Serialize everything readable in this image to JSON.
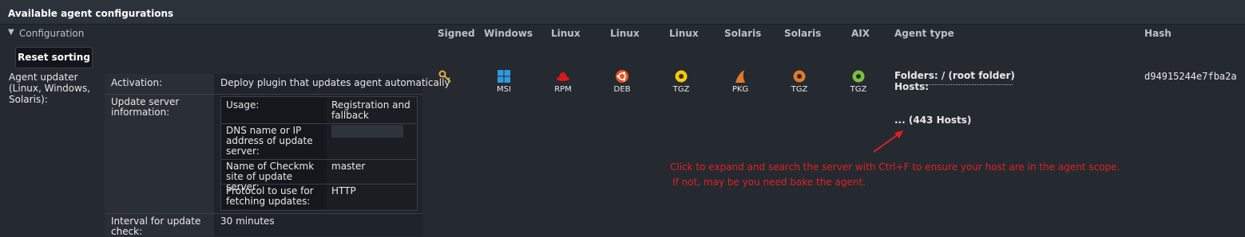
{
  "title": "Available agent configurations",
  "headers": {
    "configuration": "Configuration",
    "signed": "Signed",
    "windows": "Windows",
    "linux1": "Linux",
    "linux2": "Linux",
    "linux3": "Linux",
    "solaris1": "Solaris",
    "solaris2": "Solaris",
    "aix": "AIX",
    "agent_type": "Agent type",
    "hash": "Hash"
  },
  "reset_button": "Reset sorting",
  "agent_updater_label": "Agent updater (Linux, Windows, Solaris):",
  "activation": {
    "label": "Activation:",
    "value": "Deploy plugin that updates agent automatically"
  },
  "update_server": {
    "label": "Update server information:",
    "usage_label": "Usage:",
    "usage_value": "Registration and fallback",
    "dns_label": "DNS name or IP address of update server:",
    "site_label": "Name of Checkmk site of update server:",
    "site_value": "master",
    "protocol_label": "Protocol to use for fetching updates:",
    "protocol_value": "HTTP"
  },
  "interval": {
    "label": "Interval for update check:",
    "value": "30 minutes"
  },
  "packages": [
    "MSI",
    "RPM",
    "DEB",
    "TGZ",
    "PKG",
    "TGZ",
    "TGZ"
  ],
  "agent_type": {
    "folders": "Folders: / (root folder)",
    "hosts": "Hosts:",
    "hosts_more": "... (443 Hosts)"
  },
  "hash": "d94915244e7fba2a",
  "annotation": {
    "line1": "Click to expand and search the server with Ctrl+F to ensure your host are in the agent scope.",
    "line2": "If not, may be you need bake the agent."
  },
  "colors": {
    "annotation": "#e02020",
    "windows": "#2f9ae0",
    "redhat": "#d7191c",
    "ubuntu": "#e95420",
    "tgz": "#f2c811",
    "solaris": "#e07a2a",
    "aix": "#7ac142"
  }
}
